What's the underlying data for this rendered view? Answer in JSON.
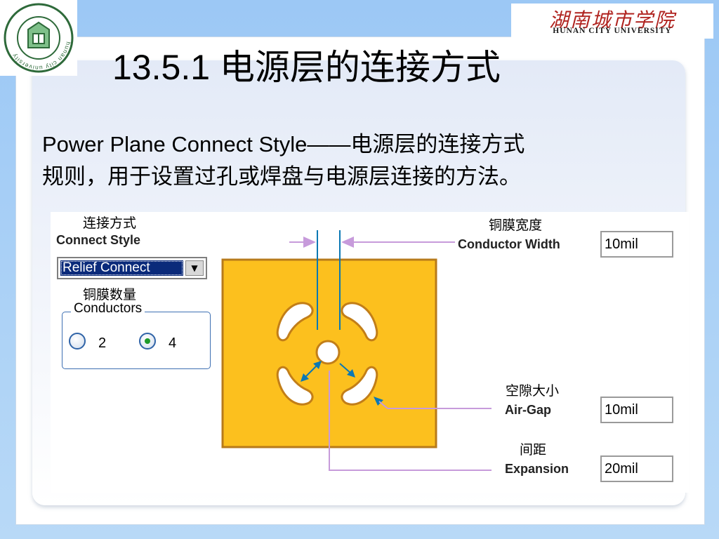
{
  "header": {
    "logo_icon": "hunan-city-university-seal",
    "logo_ring_text": "hunan city university",
    "banner_cn": "湖南城市学院",
    "banner_en": "HUNAN CITY UNIVERSITY"
  },
  "slide": {
    "title": "13.5.1  电源层的连接方式",
    "body_line1": "Power Plane Connect Style——电源层的连接方式",
    "body_line2": "规则，用于设置过孔或焊盘与电源层连接的方法。"
  },
  "dialog": {
    "connect_style": {
      "label_cn": "连接方式",
      "label_en": "Connect Style",
      "selected": "Relief Connect"
    },
    "conductors": {
      "label_cn": "铜膜数量",
      "legend": "Conductors",
      "options": [
        {
          "label": "2",
          "checked": false
        },
        {
          "label": "4",
          "checked": true
        }
      ]
    },
    "conductor_width": {
      "label_cn": "铜膜宽度",
      "label_en": "Conductor Width",
      "value": "10mil"
    },
    "air_gap": {
      "label_cn": "空隙大小",
      "label_en": "Air-Gap",
      "value": "10mil"
    },
    "expansion": {
      "label_cn": "间距",
      "label_en": "Expansion",
      "value": "20mil"
    }
  },
  "colors": {
    "slide_background": "#a9cdf0",
    "pad_fill": "#fcc01e",
    "pad_border": "#b77a1a",
    "dimension_arrow": "#0a78b4",
    "leader_line": "#c79bdb",
    "select_highlight": "#0a2a7a",
    "banner_red": "#b0231f"
  }
}
